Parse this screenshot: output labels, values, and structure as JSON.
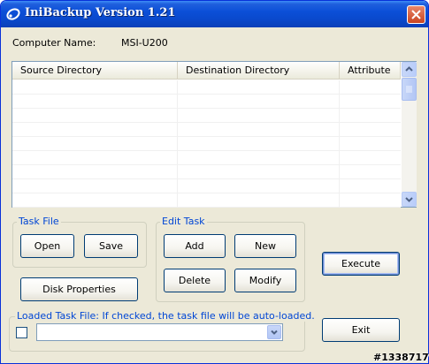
{
  "window": {
    "title": "IniBackup Version 1.21",
    "close_icon": "close-x-icon",
    "app_icon": "app-swirl-icon"
  },
  "computer": {
    "label": "Computer Name:",
    "value": "MSI-U200"
  },
  "listview": {
    "columns": [
      "Source Directory",
      "Destination Directory",
      "Attribute"
    ],
    "rows": []
  },
  "task_file": {
    "caption": "Task File",
    "open_label": "Open",
    "save_label": "Save"
  },
  "edit_task": {
    "caption": "Edit Task",
    "add_label": "Add",
    "new_label": "New",
    "delete_label": "Delete",
    "modify_label": "Modify"
  },
  "execute_label": "Execute",
  "disk_properties_label": "Disk Properties",
  "loaded_task": {
    "caption": "Loaded Task File: If checked, the task file will be auto-loaded.",
    "checked": false,
    "value": ""
  },
  "exit_label": "Exit",
  "watermark": "#1338717",
  "colors": {
    "titlebar": "#0b4fd8",
    "window_bg": "#ece9d8",
    "group_caption": "#0046d5",
    "close_button": "#c94421"
  }
}
